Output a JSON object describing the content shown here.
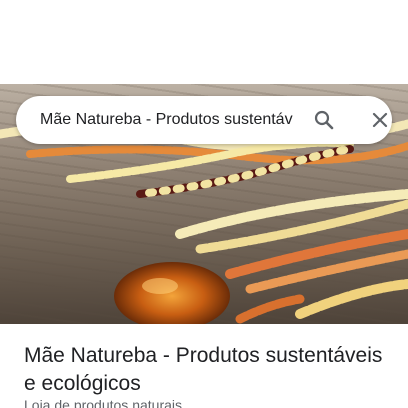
{
  "search": {
    "query": "Mãe Natureba - Produtos sustentáv",
    "search_icon": "search-icon",
    "close_icon": "close-icon"
  },
  "hero": {
    "image": "amber-necklaces-on-wood-photo"
  },
  "place": {
    "title": "Mãe Natureba - Produtos sustentáveis e ecológicos",
    "category": "Loja de produtos naturais"
  },
  "colors": {
    "text_primary": "#202124",
    "text_secondary": "#5f6368",
    "icon": "#5f6368"
  }
}
